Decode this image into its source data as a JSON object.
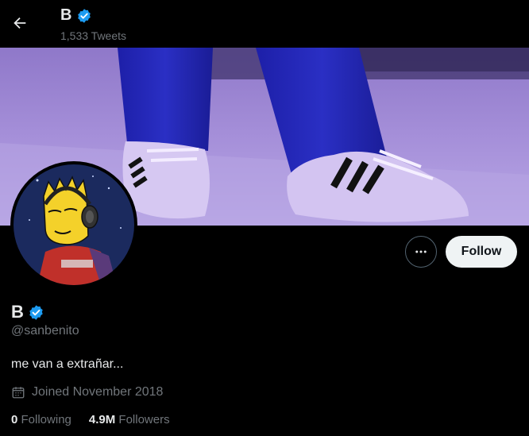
{
  "header": {
    "name": "B",
    "tweets_count": "1,533 Tweets"
  },
  "actions": {
    "follow_label": "Follow"
  },
  "profile": {
    "display_name": "B",
    "handle": "@sanbenito",
    "bio": "me van a extrañar...",
    "joined": "Joined November 2018",
    "following_count": "0",
    "following_label": "Following",
    "followers_count": "4.9M",
    "followers_label": "Followers"
  },
  "colors": {
    "background": "#000000",
    "verified_badge": "#1d9bf0",
    "follow_button_bg": "#eff3f4",
    "muted_text": "#71767b"
  },
  "icons": {
    "back": "arrow-left-icon",
    "verified": "verified-badge-icon",
    "more": "more-horizontal-icon",
    "calendar": "calendar-icon"
  }
}
